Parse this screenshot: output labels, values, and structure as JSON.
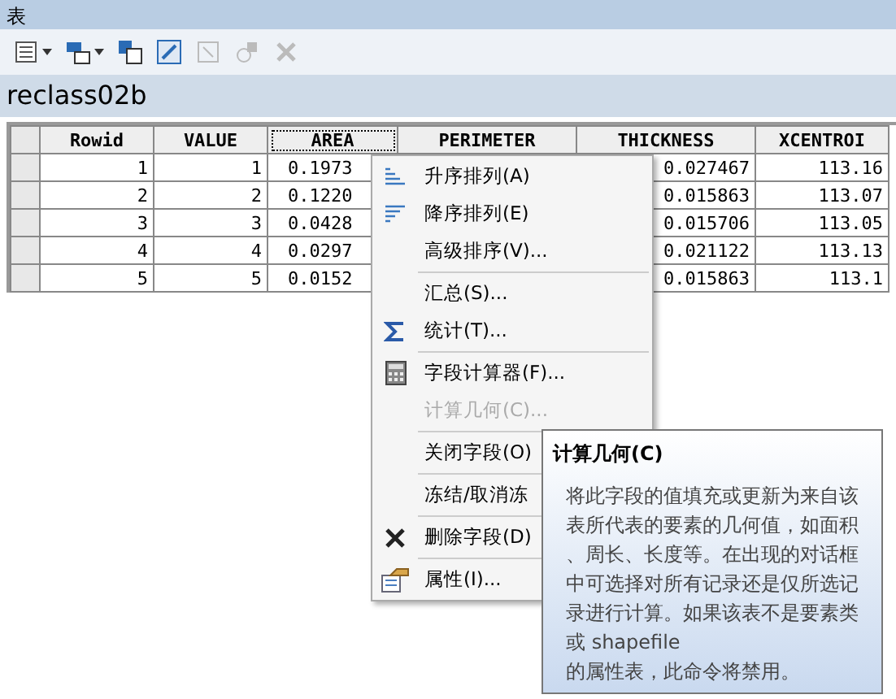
{
  "window": {
    "title": "表"
  },
  "toolbar": [
    {
      "kind": "options",
      "dropdown": true,
      "disabled": false
    },
    {
      "kind": "relate",
      "dropdown": true,
      "disabled": false
    },
    {
      "kind": "select",
      "dropdown": false,
      "disabled": false
    },
    {
      "kind": "switch",
      "dropdown": false,
      "disabled": false
    },
    {
      "kind": "clear",
      "dropdown": false,
      "disabled": true
    },
    {
      "kind": "zoom",
      "dropdown": false,
      "disabled": true
    },
    {
      "kind": "remove",
      "dropdown": false,
      "disabled": true
    }
  ],
  "table": {
    "name": "reclass02b",
    "columns": [
      {
        "label": "Rowid",
        "selected": false
      },
      {
        "label": "VALUE",
        "selected": false
      },
      {
        "label": "AREA",
        "selected": true
      },
      {
        "label": "PERIMETER",
        "selected": false
      },
      {
        "label": "THICKNESS",
        "selected": false
      },
      {
        "label": "XCENTROI",
        "selected": false
      }
    ],
    "rows": [
      [
        "1",
        "1",
        "0.1973",
        "",
        "0.027467",
        "113.16"
      ],
      [
        "2",
        "2",
        "0.1220",
        "",
        "0.015863",
        "113.07"
      ],
      [
        "3",
        "3",
        "0.0428",
        "",
        "0.015706",
        "113.05"
      ],
      [
        "4",
        "4",
        "0.0297",
        "",
        "0.021122",
        "113.13"
      ],
      [
        "5",
        "5",
        "0.0152",
        "",
        "0.015863",
        "113.1"
      ]
    ]
  },
  "context_menu": {
    "groups": [
      [
        {
          "label": "升序排列(A)",
          "kind": "ascending",
          "disabled": false
        },
        {
          "label": "降序排列(E)",
          "kind": "descending",
          "disabled": false
        },
        {
          "label": "高级排序(V)...",
          "kind": "plain",
          "disabled": false
        }
      ],
      [
        {
          "label": "汇总(S)...",
          "kind": "plain",
          "disabled": false
        },
        {
          "label": "统计(T)...",
          "kind": "statistics",
          "disabled": false
        }
      ],
      [
        {
          "label": "字段计算器(F)...",
          "kind": "calculator",
          "disabled": false
        },
        {
          "label": "计算几何(C)...",
          "kind": "plain",
          "disabled": true
        }
      ],
      [
        {
          "label": "关闭字段(O)",
          "kind": "plain",
          "disabled": false
        }
      ],
      [
        {
          "label": "冻结/取消冻",
          "kind": "plain",
          "disabled": false
        }
      ],
      [
        {
          "label": "删除字段(D)",
          "kind": "delete",
          "disabled": false
        }
      ],
      [
        {
          "label": "属性(I)...",
          "kind": "properties",
          "disabled": false
        }
      ]
    ]
  },
  "tooltip": {
    "title": "计算几何(C)",
    "text": "将此字段的值填充或更新为来自该表所代表的要素的几何值，如面积、周长、长度等。在出现的对话框中可选择对所有记录还是仅所选记录进行计算。如果该表不是要素类或 shapefile\n的属性表，此命令将禁用。"
  }
}
